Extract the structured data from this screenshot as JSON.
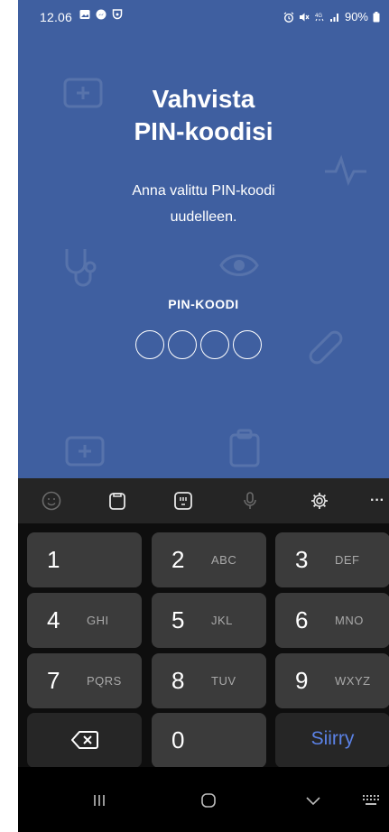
{
  "status_bar": {
    "time": "12.06",
    "battery": "90%",
    "left_icons": [
      "image-icon",
      "messenger-icon",
      "shield-icon"
    ],
    "right_icons": [
      "alarm-icon",
      "mute-icon",
      "4g-icon",
      "signal-icon",
      "battery-icon"
    ]
  },
  "screen": {
    "title_line1": "Vahvista",
    "title_line2": "PIN-koodisi",
    "subtitle_line1": "Anna valittu PIN-koodi",
    "subtitle_line2": "uudelleen.",
    "pin_label": "PIN-KOODI",
    "pin_entered": 0,
    "pin_length": 4
  },
  "keyboard_toolbar": {
    "icons": [
      "emoji-icon",
      "clipboard-icon",
      "sticker-icon",
      "mic-icon",
      "settings-icon",
      "more-icon"
    ],
    "more_label": "···"
  },
  "keypad": {
    "rows": [
      [
        {
          "num": "1",
          "letters": ""
        },
        {
          "num": "2",
          "letters": "ABC"
        },
        {
          "num": "3",
          "letters": "DEF"
        }
      ],
      [
        {
          "num": "4",
          "letters": "GHI"
        },
        {
          "num": "5",
          "letters": "JKL"
        },
        {
          "num": "6",
          "letters": "MNO"
        }
      ],
      [
        {
          "num": "7",
          "letters": "PQRS"
        },
        {
          "num": "8",
          "letters": "TUV"
        },
        {
          "num": "9",
          "letters": "WXYZ"
        }
      ]
    ],
    "zero": "0",
    "go_label": "Siirry"
  },
  "colors": {
    "app_background": "#3f5fa0",
    "key": "#3b3b3b",
    "keyboard_background": "#0e0e0e",
    "go_text": "#5b82e6"
  }
}
